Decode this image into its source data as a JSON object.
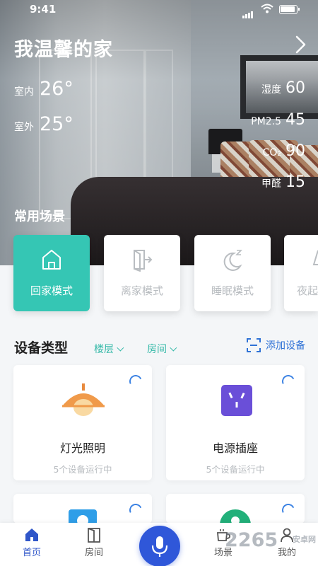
{
  "status_bar": {
    "time": "9:41"
  },
  "header": {
    "title": "我温馨的家"
  },
  "climate": {
    "indoor": {
      "label": "室内",
      "value": "26°"
    },
    "outdoor": {
      "label": "室外",
      "value": "25°"
    }
  },
  "environment": [
    {
      "label": "湿度",
      "value": "60"
    },
    {
      "label": "PM2.5",
      "value": "45"
    },
    {
      "label": "CO₂",
      "value": "90"
    },
    {
      "label": "甲醛",
      "value": "15"
    }
  ],
  "scenes": {
    "title": "常用场景",
    "items": [
      {
        "label": "回家模式",
        "icon": "home-icon",
        "active": true
      },
      {
        "label": "离家模式",
        "icon": "exit-door-icon",
        "active": false
      },
      {
        "label": "睡眠模式",
        "icon": "moon-icon",
        "active": false
      },
      {
        "label": "夜起",
        "icon": "night-lamp-icon",
        "active": false
      }
    ]
  },
  "devices": {
    "title": "设备类型",
    "filters": [
      {
        "label": "楼层"
      },
      {
        "label": "房间"
      }
    ],
    "add_label": "添加设备",
    "items": [
      {
        "name": "灯光照明",
        "sub": "5个设备运行中",
        "icon": "pendant-lamp-icon"
      },
      {
        "name": "电源插座",
        "sub": "5个设备运行中",
        "icon": "power-socket-icon"
      },
      {
        "name": "",
        "sub": "",
        "icon": "camera-icon"
      },
      {
        "name": "",
        "sub": "",
        "icon": "user-icon"
      }
    ]
  },
  "tabbar": {
    "items": [
      {
        "label": "首页",
        "icon": "home-icon",
        "active": true
      },
      {
        "label": "房间",
        "icon": "door-icon",
        "active": false
      },
      {
        "label": "场景",
        "icon": "cup-icon",
        "active": false
      },
      {
        "label": "我的",
        "icon": "person-icon",
        "active": false
      }
    ],
    "mic_icon": "microphone-icon"
  },
  "watermark": {
    "text": "2265",
    "sub": "安卓网"
  },
  "colors": {
    "accent": "#35c6b4",
    "primary_blue": "#2f57d9",
    "link_blue": "#2f72d6"
  }
}
